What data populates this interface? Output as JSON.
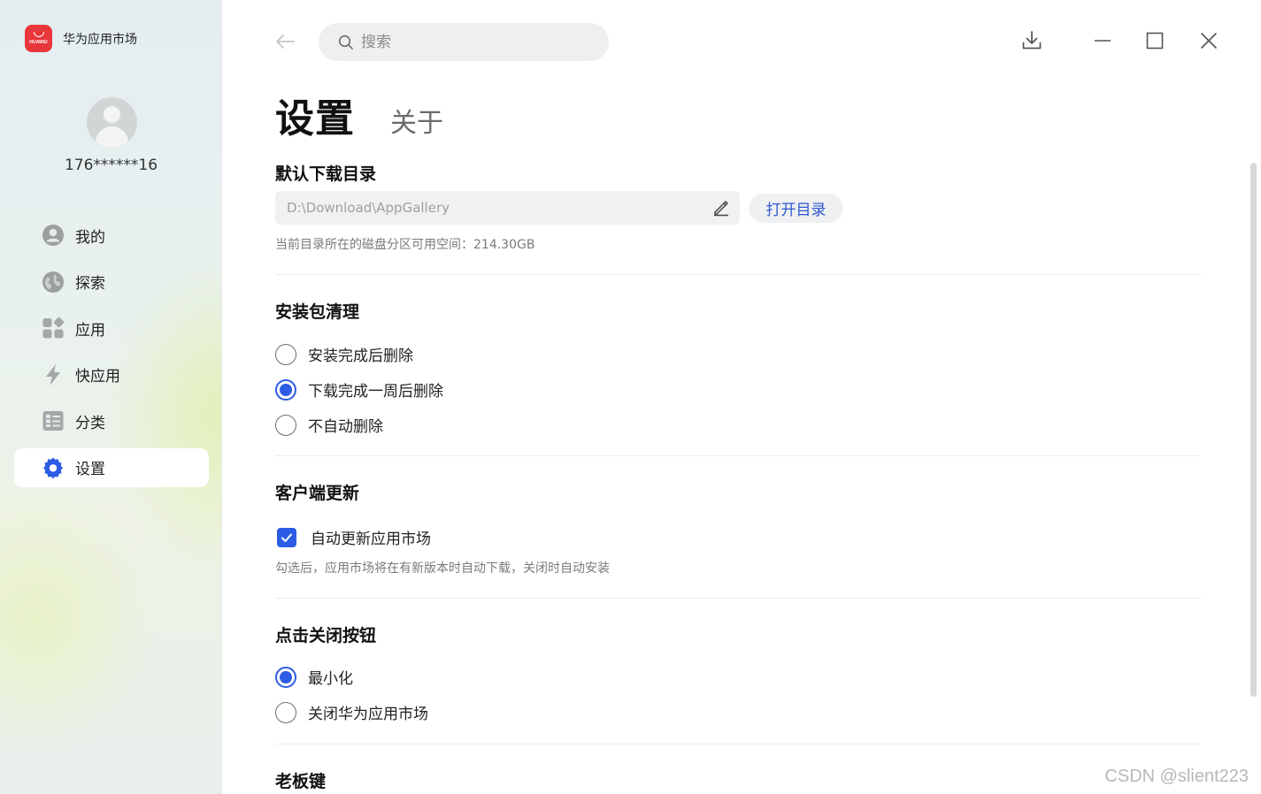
{
  "app": {
    "brand_name": "华为应用市场",
    "logo_text": "HUAWEI",
    "accent_color": "#2c5ce3",
    "logo_color": "#e8373b"
  },
  "user": {
    "name": "176******16"
  },
  "sidebar": {
    "items": [
      {
        "label": "我的",
        "icon": "user-icon",
        "active": false
      },
      {
        "label": "探索",
        "icon": "globe-icon",
        "active": false
      },
      {
        "label": "应用",
        "icon": "apps-grid-icon",
        "active": false
      },
      {
        "label": "快应用",
        "icon": "lightning-icon",
        "active": false
      },
      {
        "label": "分类",
        "icon": "list-category-icon",
        "active": false
      },
      {
        "label": "设置",
        "icon": "gear-icon",
        "active": true
      }
    ]
  },
  "topbar": {
    "search_placeholder": "搜索"
  },
  "tabs": {
    "active": "设置",
    "other": "关于"
  },
  "download_dir": {
    "title": "默认下载目录",
    "path": "D:\\Download\\AppGallery",
    "open_button": "打开目录",
    "free_space_hint": "当前目录所在的磁盘分区可用空间：214.30GB"
  },
  "package_cleanup": {
    "title": "安装包清理",
    "options": [
      {
        "label": "安装完成后删除",
        "checked": false
      },
      {
        "label": "下载完成一周后删除",
        "checked": true
      },
      {
        "label": "不自动删除",
        "checked": false
      }
    ]
  },
  "client_update": {
    "title": "客户端更新",
    "checkbox_label": "自动更新应用市场",
    "checked": true,
    "hint": "勾选后，应用市场将在有新版本时自动下载，关闭时自动安装"
  },
  "close_button_behavior": {
    "title": "点击关闭按钮",
    "options": [
      {
        "label": "最小化",
        "checked": true
      },
      {
        "label": "关闭华为应用市场",
        "checked": false
      }
    ]
  },
  "boss_key": {
    "title": "老板键"
  },
  "watermark": "CSDN @slient223"
}
